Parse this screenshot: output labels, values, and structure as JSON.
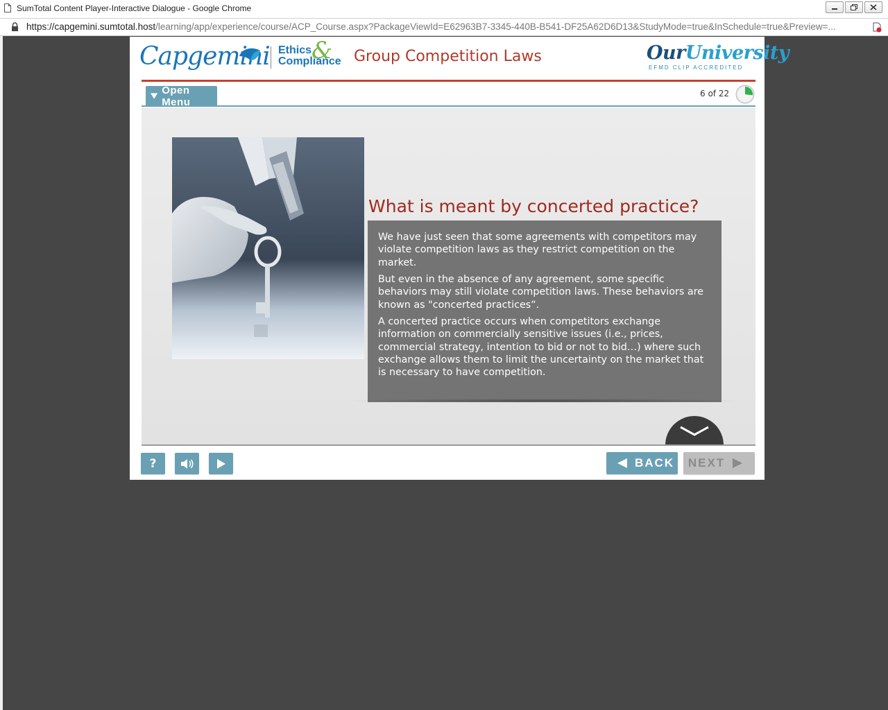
{
  "window": {
    "title": "SumTotal Content Player-Interactive Dialogue - Google Chrome",
    "url_host": "https://capgemini.sumtotal.host",
    "url_path": "/learning/app/experience/course/ACP_Course.aspx?PackageViewId=E62963B7-3345-440B-B541-DF25A62D6D13&StudyMode=true&InSchedule=true&Preview=..."
  },
  "header": {
    "logo_capgemini": "Capgemini",
    "logo_ethics": "Ethics",
    "logo_amp": "&",
    "logo_compliance": "Compliance",
    "course_title": "Group Competition Laws",
    "logo_university_our": "Our",
    "logo_university_name": "University",
    "logo_accredited": "EFMD CLIP ACCREDITED"
  },
  "toolbar": {
    "menu_label": "Open Menu",
    "progress_text": "6 of 22",
    "progress_fraction": 0.27
  },
  "slide": {
    "heading": "What is meant by concerted practice?",
    "paragraphs": [
      "We have just seen that some agreements with competitors may violate competition laws as they restrict competition on the market.",
      "But even in the absence of any agreement, some specific behaviors may still violate competition laws. These behaviors are known as \"concerted practices“.",
      "A concerted practice occurs when competitors exchange information on commercially sensitive issues (i.e., prices, commercial strategy, intention to bid or not to bid…) where such exchange allows them to limit the uncertainty on the market that is necessary to have competition."
    ]
  },
  "footer": {
    "help_label": "?",
    "back_label": "BACK",
    "next_label": "NEXT"
  },
  "colors": {
    "accent_teal": "#6aa0b4",
    "title_red": "#b03a2a",
    "brand_blue": "#1a75b8",
    "textbox_grey": "#747474"
  }
}
